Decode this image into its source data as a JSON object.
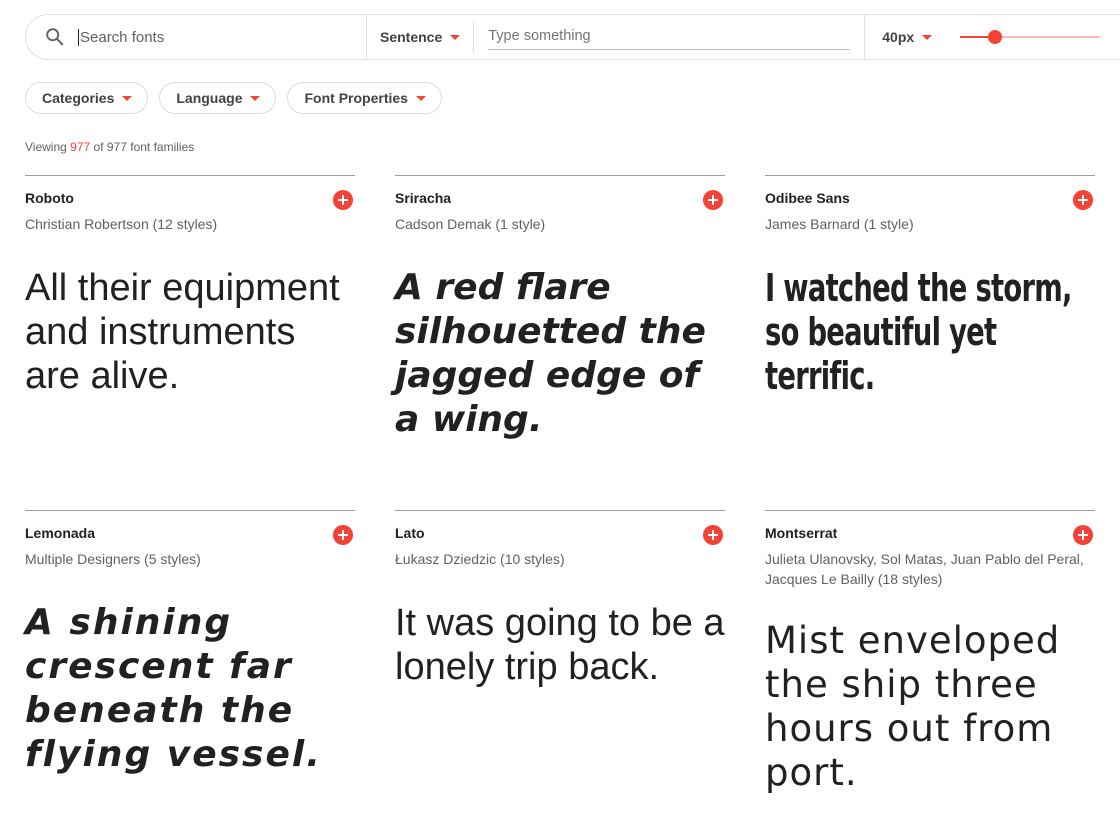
{
  "search": {
    "placeholder": "Search fonts"
  },
  "preview": {
    "type_label": "Sentence",
    "placeholder": "Type something"
  },
  "size": {
    "label": "40px",
    "slider_fraction": 0.25
  },
  "filters": {
    "categories": "Categories",
    "language": "Language",
    "font_properties": "Font Properties"
  },
  "count": {
    "prefix": "Viewing",
    "shown": "977",
    "middle": "of 977 font families"
  },
  "colors": {
    "accent": "#f44336",
    "text": "#212121",
    "muted": "#616161"
  },
  "cards": [
    {
      "name": "Roboto",
      "designer": "Christian Robertson (12 styles)",
      "sample": "All their equipment and instruments are alive."
    },
    {
      "name": "Sriracha",
      "designer": "Cadson Demak (1 style)",
      "sample": "A red flare silhouetted the jagged edge of a wing."
    },
    {
      "name": "Odibee Sans",
      "designer": "James Barnard (1 style)",
      "sample": "I watched the storm, so beautiful yet terrific."
    },
    {
      "name": "Lemonada",
      "designer": "Multiple Designers (5 styles)",
      "sample": "A shining crescent far beneath the flying vessel."
    },
    {
      "name": "Lato",
      "designer": "Łukasz Dziedzic (10 styles)",
      "sample": "It was going to be a lonely trip back."
    },
    {
      "name": "Montserrat",
      "designer": "Julieta Ulanovsky, Sol Matas, Juan Pablo del Peral, Jacques Le Bailly (18 styles)",
      "sample": "Mist enveloped the ship three hours out from port."
    }
  ]
}
